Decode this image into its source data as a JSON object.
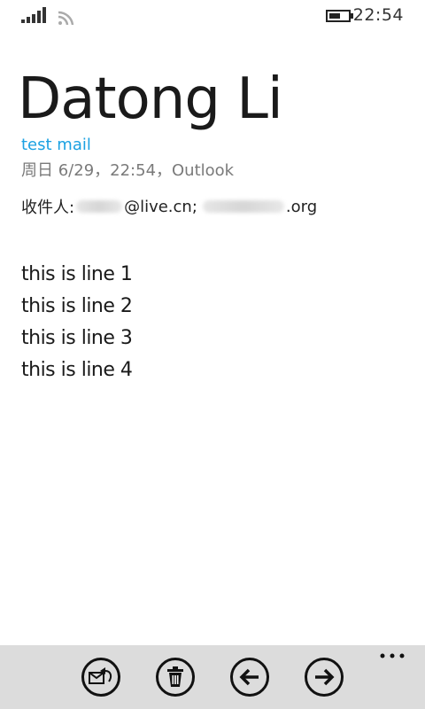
{
  "status_bar": {
    "time": "22:54",
    "icons": [
      "signal-icon",
      "wifi-icon",
      "battery-icon"
    ]
  },
  "mail": {
    "sender": "Datong Li",
    "subject": "test mail",
    "meta": "周日 6/29，22:54，Outlook",
    "recipients_label": "收件人:",
    "recipient_1_domain": "@live.cn;",
    "recipient_2_domain": ".org",
    "body_lines": [
      "this is line 1",
      "this is line 2",
      "this is line 3",
      "this is line 4"
    ]
  },
  "app_bar": {
    "buttons": [
      "reply-icon",
      "delete-icon",
      "previous-icon",
      "next-icon"
    ],
    "more": "more-icon"
  },
  "colors": {
    "accent": "#1ba1e2",
    "app_bar_bg": "#dcdcdc"
  }
}
